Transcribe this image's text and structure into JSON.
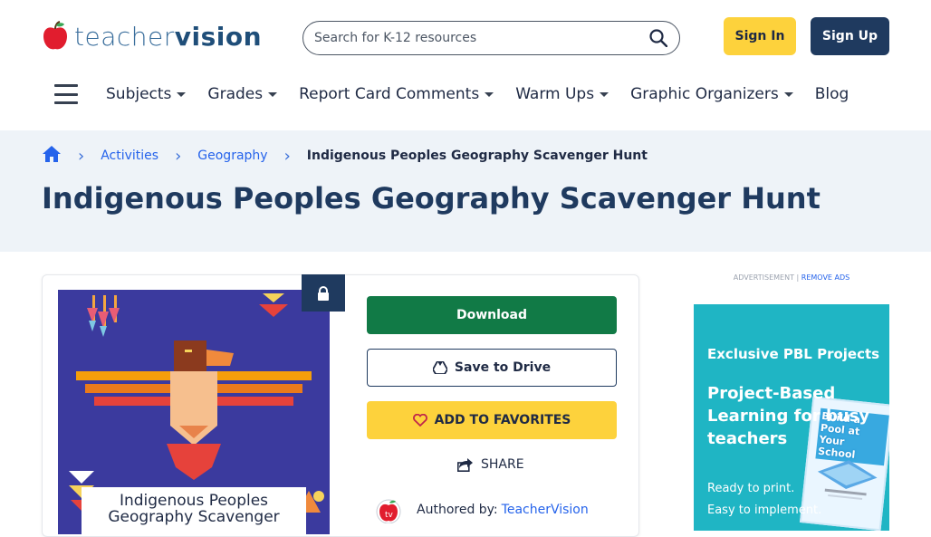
{
  "header": {
    "logo": {
      "light": "teacher",
      "bold": "vision"
    },
    "search": {
      "placeholder": "Search for K-12 resources"
    },
    "signin_label": "Sign In",
    "signup_label": "Sign Up"
  },
  "nav": {
    "items": [
      {
        "label": "Subjects",
        "dropdown": true
      },
      {
        "label": "Grades",
        "dropdown": true
      },
      {
        "label": "Report Card Comments",
        "dropdown": true
      },
      {
        "label": "Warm Ups",
        "dropdown": true
      },
      {
        "label": "Graphic Organizers",
        "dropdown": true
      },
      {
        "label": "Blog",
        "dropdown": false
      }
    ]
  },
  "breadcrumb": {
    "items": [
      {
        "label": "Activities"
      },
      {
        "label": "Geography"
      },
      {
        "label": "Indigenous Peoples Geography Scavenger Hunt"
      }
    ]
  },
  "page": {
    "title": "Indigenous Peoples Geography Scavenger Hunt"
  },
  "resource": {
    "thumbnail_caption": "Indigenous Peoples Geography Scavenger",
    "download_label": "Download",
    "drive_label": "Save to Drive",
    "favorites_label": "ADD TO FAVORITES",
    "share_label": "SHARE",
    "author_prefix": "Authored by:",
    "author_name": "TeacherVision"
  },
  "ad": {
    "label": "ADVERTISEMENT |",
    "remove_label": "REMOVE ADS",
    "headline": "Exclusive PBL Projects",
    "subhead": "Project-Based Learning for busy teachers",
    "body_line1": "Ready to print.",
    "body_line2": "Easy to implement.",
    "book_title": "Build a Pool at Your School"
  },
  "colors": {
    "brand_navy": "#1f3a5f",
    "accent_yellow": "#fdd23c",
    "download_green": "#117a46",
    "link_blue": "#2563eb",
    "ad_teal": "#1fb5c4"
  }
}
